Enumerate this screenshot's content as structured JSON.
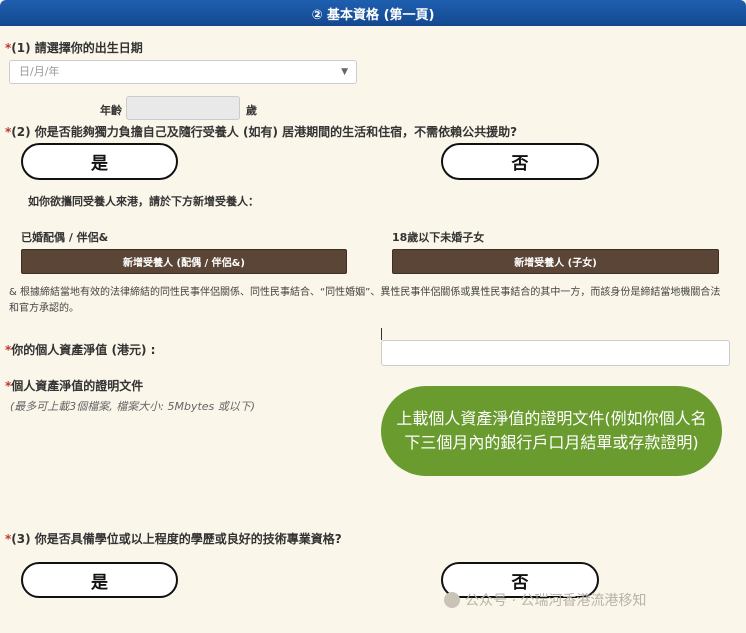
{
  "header": {
    "title": "② 基本資格 (第一頁)"
  },
  "q1": {
    "star": "*",
    "label": "(1) 請選擇你的出生日期",
    "date_placeholder": "日/月/年",
    "age_prefix": "年齡",
    "age_suffix": "歲"
  },
  "q2": {
    "star": "*",
    "label": "(2) 你是否能夠獨力負擔自己及隨行受養人 (如有) 居港期間的生活和住宿，不需依賴公共援助?",
    "yes": "是",
    "no": "否",
    "dependents_prompt": "如你欲攜同受養人來港，請於下方新增受養人：",
    "spouse_label": "已婚配偶 / 伴侶&",
    "child_label": "18歲以下未婚子女",
    "add_spouse_button": "新增受養人 (配偶 / 伴侶&)",
    "add_child_button": "新增受養人 (子女)",
    "footnote": "& 根據締結當地有效的法律締結的同性民事伴侶關係、同性民事結合、“同性婚姻”、異性民事伴侶關係或異性民事結合的其中一方，而該身份是締結當地機關合法和官方承認的。"
  },
  "assets": {
    "star": "*",
    "label": "你的個人資產淨值 (港元) :"
  },
  "proof": {
    "star": "*",
    "label": "個人資產淨值的證明文件",
    "hint": "(最多可上載3個檔案, 檔案大小: 5Mbytes 或以下)",
    "upload_button": "上載個人資產淨值的證明文件(例如你個人名下三個月內的銀行戶口月結單或存款證明)"
  },
  "q3": {
    "star": "*",
    "label": "(3) 你是否具備學位或以上程度的學歷或良好的技術專業資格?",
    "yes": "是",
    "no": "否"
  },
  "watermark": {
    "text": "公众号 · 公瑞河香港流港移知"
  },
  "colors": {
    "header": "#1f5fb0",
    "brown_button": "#5a4536",
    "upload_green": "#6a9b2f",
    "required_star": "#c0392b"
  }
}
